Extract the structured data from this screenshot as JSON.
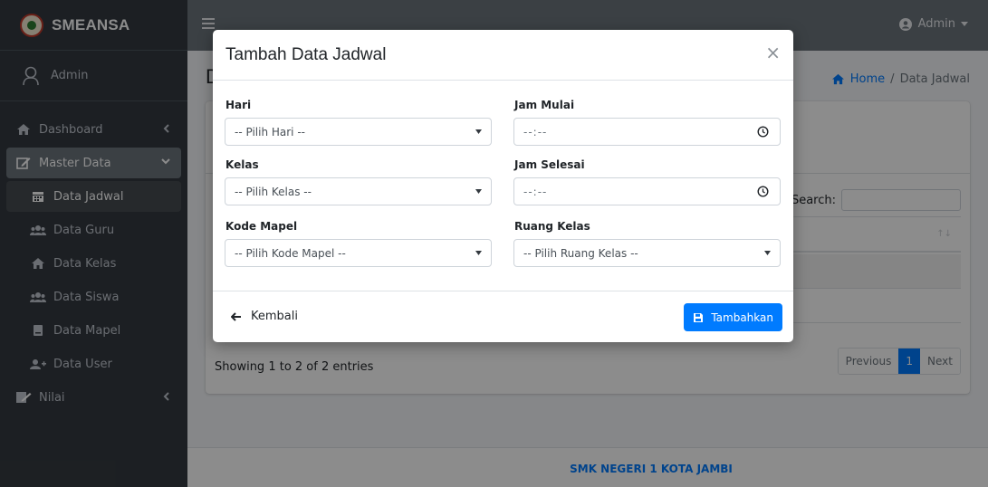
{
  "app": {
    "brand": "SMEANSA"
  },
  "user_panel": {
    "name": "Admin"
  },
  "sidebar": {
    "items": [
      {
        "label": "Dashboard",
        "icon": "home-icon"
      },
      {
        "label": "Master Data",
        "icon": "edit-icon"
      },
      {
        "label": "Data Jadwal",
        "icon": "calendar-icon"
      },
      {
        "label": "Data Guru",
        "icon": "users-icon"
      },
      {
        "label": "Data Kelas",
        "icon": "home-icon"
      },
      {
        "label": "Data Siswa",
        "icon": "users-icon"
      },
      {
        "label": "Data Mapel",
        "icon": "book-icon"
      },
      {
        "label": "Data User",
        "icon": "user-plus-icon"
      },
      {
        "label": "Nilai",
        "icon": "signature-icon"
      }
    ]
  },
  "navbar": {
    "user": "Admin"
  },
  "breadcrumb": {
    "home": "Home",
    "separator": "/",
    "current": "Data Jadwal"
  },
  "page": {
    "title_initial": "D"
  },
  "table": {
    "search_label": "Search:",
    "info": "Showing 1 to 2 of 2 entries",
    "pagination": {
      "previous": "Previous",
      "current": "1",
      "next": "Next"
    }
  },
  "footer": {
    "text": "SMK NEGERI 1 KOTA JAMBI"
  },
  "modal": {
    "title": "Tambah Data Jadwal",
    "close": "×",
    "fields": {
      "hari": {
        "label": "Hari",
        "value": "-- Pilih Hari --"
      },
      "kelas": {
        "label": "Kelas",
        "value": "-- Pilih Kelas --"
      },
      "kode_mapel": {
        "label": "Kode Mapel",
        "value": "-- Pilih Kode Mapel --"
      },
      "jam_mulai": {
        "label": "Jam Mulai",
        "value": "--:--"
      },
      "jam_selesai": {
        "label": "Jam Selesai",
        "value": "--:--"
      },
      "ruang_kelas": {
        "label": "Ruang Kelas",
        "value": "-- Pilih Ruang Kelas --"
      }
    },
    "back_button": "Kembali",
    "submit_button": "Tambahkan"
  },
  "colors": {
    "primary": "#007bff",
    "sidebar": "#343a40",
    "navbar": "#6c757d"
  }
}
